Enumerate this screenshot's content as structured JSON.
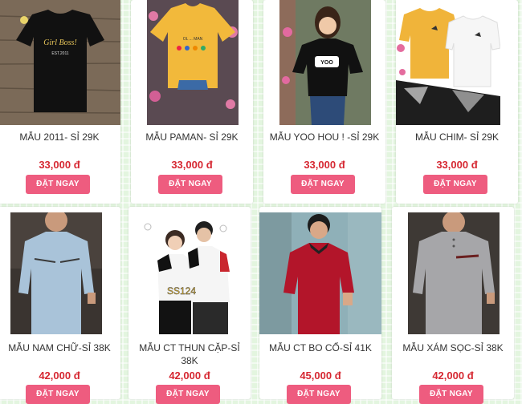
{
  "products": [
    {
      "name": "MẪU 2011- SỈ 29K",
      "price": "33,000 đ",
      "button": "ĐẶT NGAY",
      "image_print": "Girl Boss!",
      "image_sub": "EST.2011"
    },
    {
      "name": "MẪU PAMAN- SỈ 29K",
      "price": "33,000 đ",
      "button": "ĐẶT NGAY"
    },
    {
      "name": "MẪU YOO HOU ! -SỈ 29K",
      "price": "33,000 đ",
      "button": "ĐẶT NGAY"
    },
    {
      "name": "MẪU CHIM- SỈ 29K",
      "price": "33,000 đ",
      "button": "ĐẶT NGAY"
    },
    {
      "name": "MẪU NAM CHỮ-SỈ 38K",
      "price": "42,000 đ",
      "button": "ĐẶT NGAY"
    },
    {
      "name": "MẪU CT THUN CẶP-SỈ 38K",
      "price": "42,000 đ",
      "button": "ĐẶT NGAY",
      "image_print": "SS124"
    },
    {
      "name": "MẪU CT BO CỔ-SỈ 41K",
      "price": "45,000 đ",
      "button": "ĐẶT NGAY"
    },
    {
      "name": "MẪU XÁM SỌC-SỈ 38K",
      "price": "42,000 đ",
      "button": "ĐẶT NGAY"
    }
  ]
}
